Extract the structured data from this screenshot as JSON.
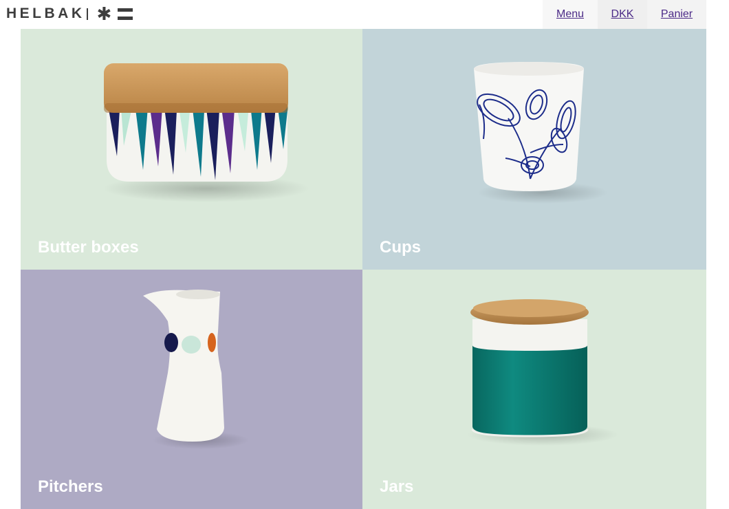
{
  "brand": {
    "name": "HELBAK",
    "star": "✱"
  },
  "nav": {
    "menu": "Menu",
    "currency": "DKK",
    "cart": "Panier",
    "link_color": "#4b2a87"
  },
  "tiles": [
    {
      "label": "Butter boxes",
      "bg": "#dae9da"
    },
    {
      "label": "Cups",
      "bg": "#c2d4d9"
    },
    {
      "label": "Pitchers",
      "bg": "#aeaac4"
    },
    {
      "label": "Jars",
      "bg": "#dae9da"
    }
  ]
}
